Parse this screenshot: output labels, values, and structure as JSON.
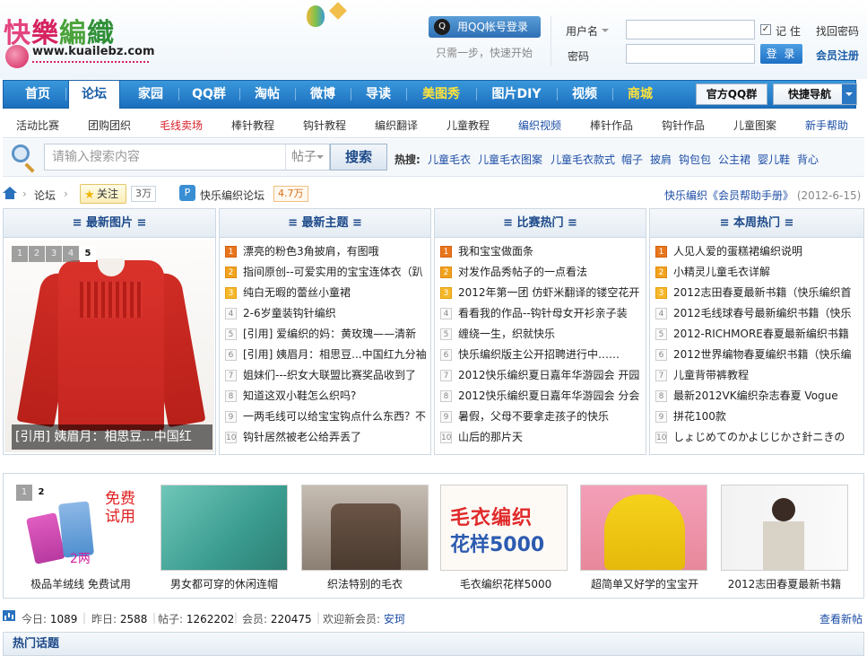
{
  "brand": {
    "name_cn": [
      "快",
      "樂",
      "編",
      "織"
    ],
    "url": "www.kuailebz.com",
    "colors": {
      "pink": "#d6225f",
      "green": "#3a9b38",
      "nav_blue": "#1b6fbd",
      "link_blue": "#1d4ea6"
    }
  },
  "login": {
    "qq_button": "用QQ帐号登录",
    "qq_tip": "只需一步，快速开始",
    "username_label": "用户名",
    "password_label": "密码",
    "remember": "记 住",
    "forgot": "找回密码",
    "login_button": "登 录",
    "register": "会员注册",
    "remember_checked": true
  },
  "nav": {
    "items": [
      {
        "label": "首页"
      },
      {
        "label": "论坛",
        "active": true
      },
      {
        "label": "家园"
      },
      {
        "label": "QQ群"
      },
      {
        "label": "淘帖"
      },
      {
        "label": "微博"
      },
      {
        "label": "导读"
      },
      {
        "label": "美图秀",
        "highlight": true
      },
      {
        "label": "图片DIY"
      },
      {
        "label": "视频"
      },
      {
        "label": "商城",
        "highlight": true
      }
    ],
    "qq_group": "官方QQ群",
    "quick_nav": "快捷导航"
  },
  "subnav": [
    {
      "label": "活动比赛"
    },
    {
      "label": "团购团织"
    },
    {
      "label": "毛线卖场",
      "color": "red"
    },
    {
      "label": "棒针教程"
    },
    {
      "label": "钩针教程"
    },
    {
      "label": "编织翻译"
    },
    {
      "label": "儿童教程"
    },
    {
      "label": "编织视频",
      "color": "blue"
    },
    {
      "label": "棒针作品"
    },
    {
      "label": "钩针作品"
    },
    {
      "label": "儿童图案"
    },
    {
      "label": "新手帮助",
      "color": "blue"
    }
  ],
  "search": {
    "placeholder": "请输入搜索内容",
    "type": "帖子",
    "button": "搜索",
    "hot_label": "热搜:",
    "hot": [
      "儿童毛衣",
      "儿童毛衣图案",
      "儿童毛衣款式",
      "帽子",
      "披肩",
      "钩包包",
      "公主裙",
      "婴儿鞋",
      "背心"
    ]
  },
  "breadcrumb": {
    "forum": "论坛",
    "follow": "关注",
    "follow_count": "3万",
    "board": "快乐编织论坛",
    "board_count": "4.7万",
    "notice": "快乐编织《会员帮助手册》",
    "notice_date": "(2012-6-15)"
  },
  "panels": {
    "pictures": {
      "title": "≡ 最新图片 ≡",
      "pager": [
        "1",
        "2",
        "3",
        "4",
        "5"
      ],
      "current_page": "5",
      "caption": "[引用] 姨眉月：相思豆...中国红"
    },
    "new": {
      "title": "≡ 最新主题 ≡",
      "items": [
        "漂亮的粉色3角披肩，有图哦",
        "指间原创--可爱实用的宝宝连体衣（趴",
        "纯白无暇的蕾丝小童裙",
        "2-6岁童装钩针编织",
        "[引用] 爱编织的妈：黄玫瑰——清新",
        "[引用] 姨眉月：相思豆...中国红九分袖",
        "姐妹们---织女大联盟比赛奖品收到了",
        "知道这双小鞋怎么织吗?",
        "一两毛线可以给宝宝钩点什么东西？不",
        "钩针居然被老公给弄丢了"
      ]
    },
    "contest": {
      "title": "≡ 比赛热门 ≡",
      "items": [
        "我和宝宝做面条",
        "对发作品秀帖子的一点看法",
        "2012年第一团 仿虾米翻译的镂空花开",
        "看看我的作品--钩针母女开衫亲子装",
        "缠绕一生，织就快乐",
        "快乐编织版主公开招聘进行中……",
        "2012快乐编织夏日嘉年华游园会 开园",
        "2012快乐编织夏日嘉年华游园会 分会",
        "暑假，父母不要拿走孩子的快乐",
        "山后的那片天"
      ]
    },
    "week": {
      "title": "≡ 本周热门 ≡",
      "items": [
        "人见人爱的蛋糕裙编织说明",
        "小精灵儿童毛衣详解",
        "2012志田春夏最新书籍（快乐编织首",
        "2012毛线球春号最新编织书籍（快乐",
        "2012-RICHMORE春夏最新编织书籍",
        "2012世界编物春夏编织书籍（快乐编",
        "儿童背带裤教程",
        "最新2012VK编织杂志春夏 Vogue",
        "拼花100款",
        "しょじめてのかよじじかさ針ニきの"
      ]
    }
  },
  "gallery": {
    "pager": [
      "1",
      "2"
    ],
    "current_page": "2",
    "ad_text": "免费试用",
    "ad_weight": "2两",
    "poster_title": "毛衣编织",
    "poster_sub": "花样5000",
    "items": [
      "极品羊绒线 免费试用",
      "男女都可穿的休闲连帽",
      "织法特别的毛衣",
      "毛衣编织花样5000",
      "超简单又好学的宝宝开",
      "2012志田春夏最新书籍"
    ]
  },
  "stats": {
    "today_label": "今日:",
    "today": "1089",
    "yesterday_label": "昨日:",
    "yesterday": "2588",
    "posts_label": "帖子:",
    "posts": "1262202",
    "members_label": "会员:",
    "members": "220475",
    "welcome": "欢迎新会员:",
    "new_member": "安珂",
    "view_new": "查看新帖"
  },
  "hot_topics": "热门话题"
}
